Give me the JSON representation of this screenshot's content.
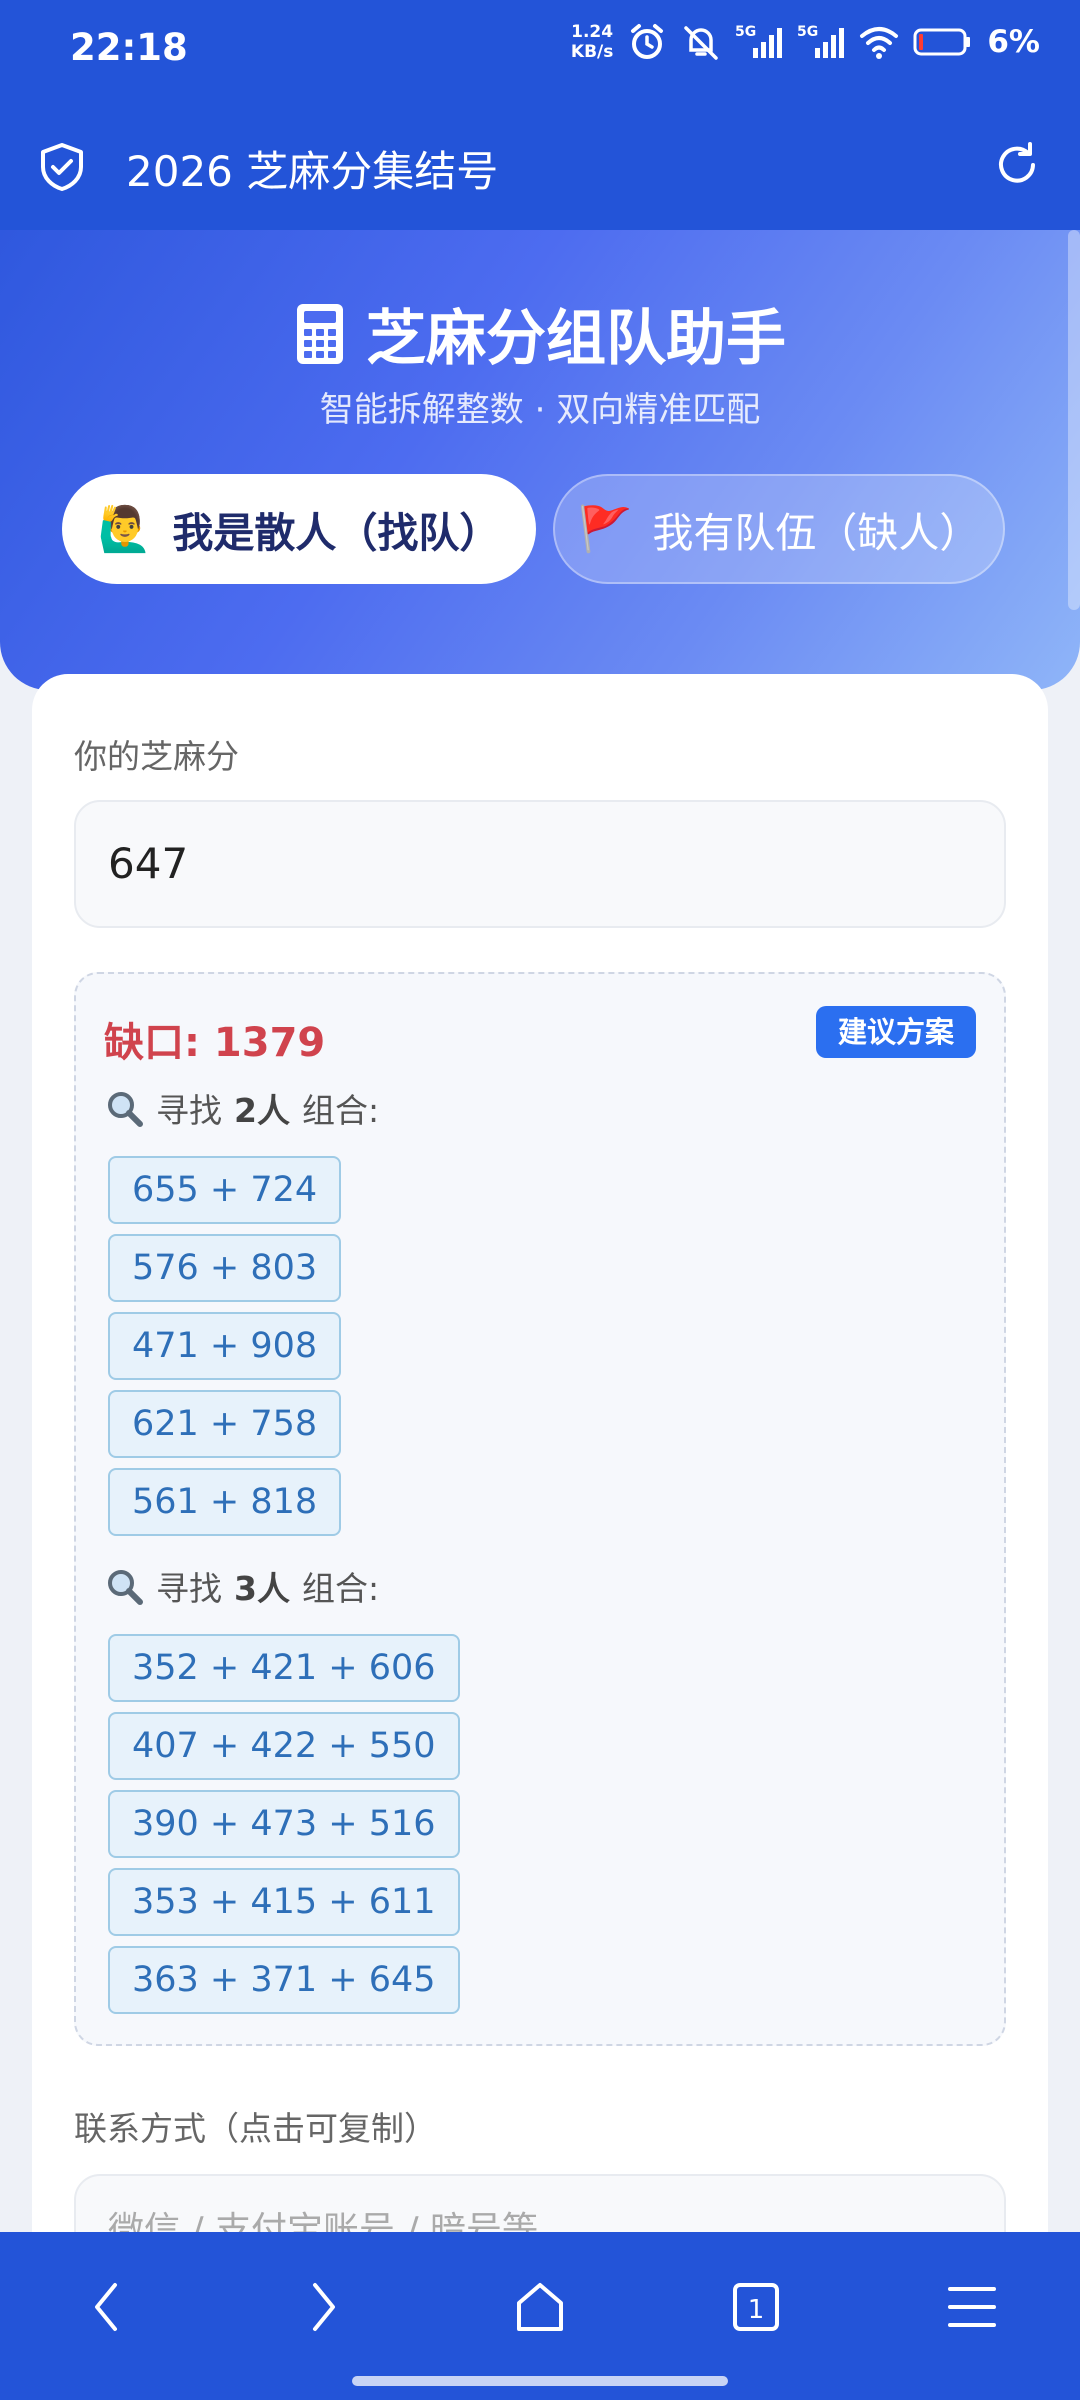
{
  "status_bar": {
    "time": "22:18",
    "net_speed_value": "1.24",
    "net_speed_unit": "KB/s",
    "signal_1": "5G",
    "signal_2": "5G",
    "battery": "6%"
  },
  "app_bar": {
    "title": "2026 芝麻分集结号"
  },
  "hero": {
    "title": "芝麻分组队助手",
    "subtitle": "智能拆解整数 · 双向精准匹配",
    "tabs": [
      {
        "emoji": "🙋‍♂️",
        "label": "我是散人（找队）",
        "active": true
      },
      {
        "emoji": "🚩",
        "label": "我有队伍（缺人）",
        "active": false
      }
    ]
  },
  "form": {
    "score_label": "你的芝麻分",
    "score_value": "647",
    "result": {
      "gap_label": "缺口: 1379",
      "suggest_badge": "建议方案",
      "groups": [
        {
          "prefix": "寻找",
          "count": "2人",
          "suffix": "组合:",
          "combos": [
            "655 + 724",
            "576 + 803",
            "471 + 908",
            "621 + 758",
            "561 + 818"
          ]
        },
        {
          "prefix": "寻找",
          "count": "3人",
          "suffix": "组合:",
          "combos": [
            "352 + 421 + 606",
            "407 + 422 + 550",
            "390 + 473 + 516",
            "353 + 415 + 611",
            "363 + 371 + 645"
          ]
        }
      ]
    },
    "contact_label": "联系方式（点击可复制）",
    "contact_placeholder": "微信 / 支付宝账号 / 暗号等"
  },
  "colors": {
    "brand_blue": "#2354d8",
    "gap_red": "#d0434d",
    "combo_text": "#2e6fb8",
    "badge_blue": "#2b6ff0"
  },
  "icons": {
    "app": "shield-check-icon",
    "refresh": "refresh-icon",
    "hero": "calculator-icon",
    "search": "magnifier-icon",
    "nav": [
      "back-icon",
      "forward-icon",
      "home-icon",
      "tabs-icon",
      "menu-icon"
    ]
  },
  "bottom_nav": {
    "tab_count": "1"
  }
}
